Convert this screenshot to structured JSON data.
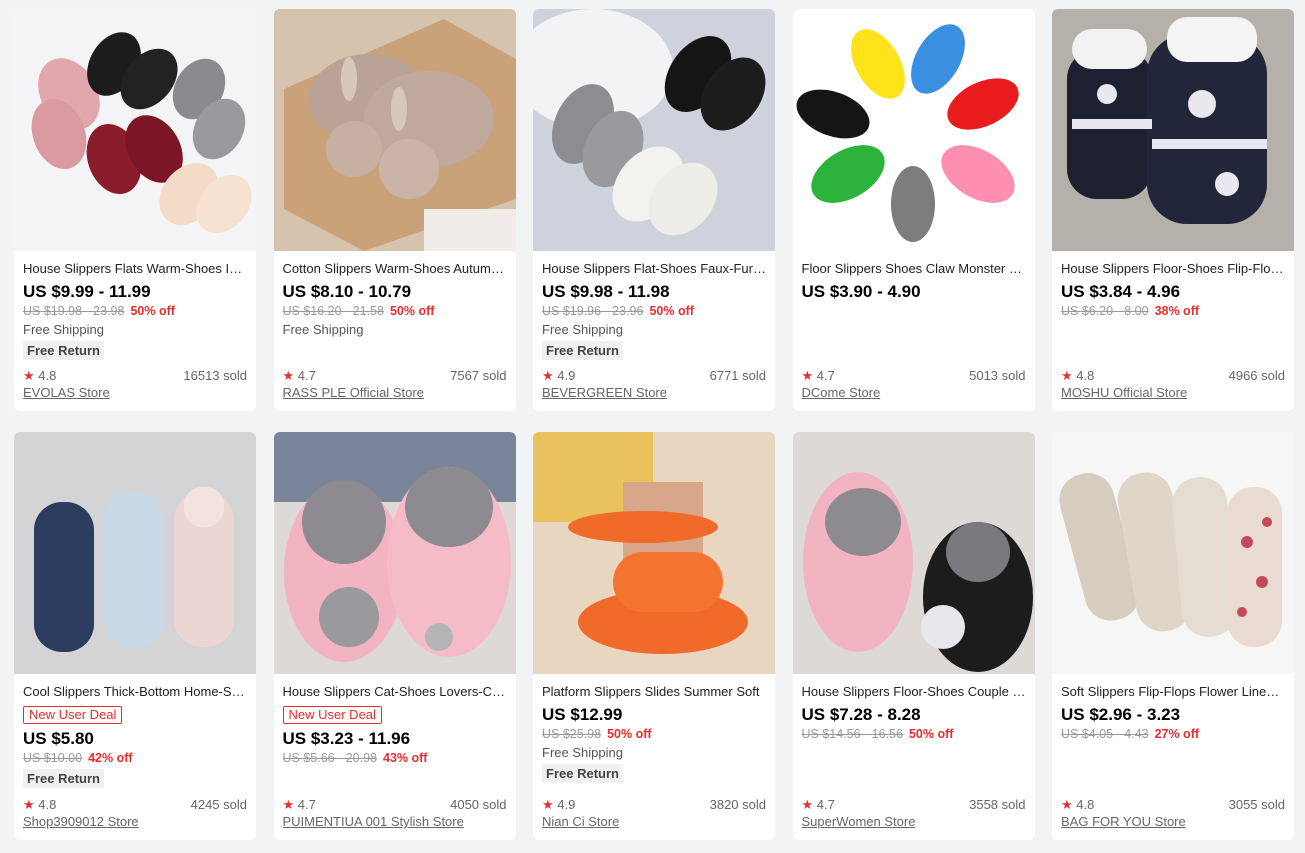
{
  "products": [
    {
      "title": "House Slippers Flats Warm-Shoes Indoor",
      "deal": "",
      "price": "US $9.99 - 11.99",
      "old_price": "US $19.98 - 23.98",
      "discount": "50% off",
      "shipping": "Free Shipping",
      "return": "Free Return",
      "rating": "4.8",
      "sold": "16513 sold",
      "store": "EVOLAS Store",
      "image_icon": "cross-band-slippers"
    },
    {
      "title": "Cotton Slippers Warm-Shoes Autumn Winter",
      "deal": "",
      "price": "US $8.10 - 10.79",
      "old_price": "US $16.20 - 21.58",
      "discount": "50% off",
      "shipping": "Free Shipping",
      "return": "",
      "rating": "4.7",
      "sold": "7567 sold",
      "store": "RASS PLE Official Store",
      "image_icon": "bunny-fur-slippers"
    },
    {
      "title": "House Slippers Flat-Shoes Faux-Fur Cross",
      "deal": "",
      "price": "US $9.98 - 11.98",
      "old_price": "US $19.96 - 23.96",
      "discount": "50% off",
      "shipping": "Free Shipping",
      "return": "Free Return",
      "rating": "4.9",
      "sold": "6771 sold",
      "store": "BEVERGREEN Store",
      "image_icon": "faux-fur-slippers"
    },
    {
      "title": "Floor Slippers Shoes Claw Monster Paw",
      "deal": "",
      "price": "US $3.90 - 4.90",
      "old_price": "",
      "discount": "",
      "shipping": "",
      "return": "",
      "rating": "4.7",
      "sold": "5013 sold",
      "store": "DCome Store",
      "image_icon": "claw-slippers"
    },
    {
      "title": "House Slippers Floor-Shoes Flip-Flops Boots",
      "deal": "",
      "price": "US $3.84 - 4.96",
      "old_price": "US $6.20 - 8.00",
      "discount": "38% off",
      "shipping": "",
      "return": "",
      "rating": "4.8",
      "sold": "4966 sold",
      "store": "MOSHU Official Store",
      "image_icon": "knit-boot-slippers"
    },
    {
      "title": "Cool Slippers Thick-Bottom Home-Shoes",
      "deal": "New User Deal",
      "price": "US $5.80",
      "old_price": "US $10.00",
      "discount": "42% off",
      "shipping": "",
      "return": "Free Return",
      "rating": "4.8",
      "sold": "4245 sold",
      "store": "Shop3909012 Store",
      "image_icon": "eva-slides"
    },
    {
      "title": "House Slippers Cat-Shoes Lovers-Cartoon",
      "deal": "New User Deal",
      "price": "US $3.23 - 11.96",
      "old_price": "US $5.66 - 20.98",
      "discount": "43% off",
      "shipping": "",
      "return": "",
      "rating": "4.7",
      "sold": "4050 sold",
      "store": "PUIMENTIUA 001 Stylish Store",
      "image_icon": "pink-cat-slippers"
    },
    {
      "title": "Platform Slippers Slides Summer Soft",
      "deal": "",
      "price": "US $12.99",
      "old_price": "US $25.98",
      "discount": "50% off",
      "shipping": "Free Shipping",
      "return": "Free Return",
      "rating": "4.9",
      "sold": "3820 sold",
      "store": "Nian Ci Store",
      "image_icon": "orange-platform-slides"
    },
    {
      "title": "House Slippers Floor-Shoes Couple Cat",
      "deal": "",
      "price": "US $7.28 - 8.28",
      "old_price": "US $14.56 - 16.56",
      "discount": "50% off",
      "shipping": "",
      "return": "",
      "rating": "4.7",
      "sold": "3558 sold",
      "store": "SuperWomen Store",
      "image_icon": "couple-cat-slippers"
    },
    {
      "title": "Soft Slippers Flip-Flops Flower Linen Home",
      "deal": "",
      "price": "US $2.96 - 3.23",
      "old_price": "US $4.05 - 4.43",
      "discount": "27% off",
      "shipping": "",
      "return": "",
      "rating": "4.8",
      "sold": "3055 sold",
      "store": "BAG FOR YOU Store",
      "image_icon": "linen-flower-slippers"
    }
  ],
  "colors": {
    "accent": "#e62e2e",
    "page_bg": "#f2f3f5"
  }
}
